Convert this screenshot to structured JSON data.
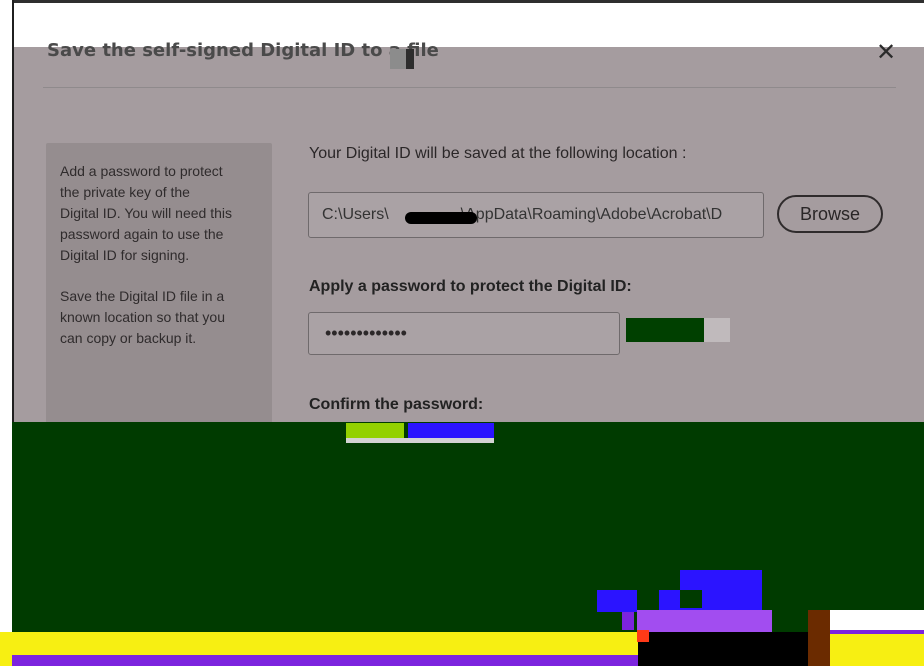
{
  "dialog": {
    "title": "Save the self-signed Digital ID to a file",
    "close_symbol": "✕"
  },
  "info_panel": {
    "paragraph1": "Add a password to protect\nthe private key of the\nDigital ID. You will need this\npassword again to use the\nDigital ID for signing.",
    "paragraph2": "Save the Digital ID file in a\nknown location so that you\ncan copy or backup it."
  },
  "location": {
    "label": "Your Digital ID will be saved at the following location :",
    "path_before_redaction": "C:\\Users\\",
    "path_after_redaction": "\\AppData\\Roaming\\Adobe\\Acrobat\\D",
    "browse_label": "Browse"
  },
  "password": {
    "label": "Apply a password to protect the Digital ID:",
    "masked_value": "•••••••••••••",
    "strength_fraction": 0.75
  },
  "confirm": {
    "label": "Confirm the password:"
  },
  "colors": {
    "dialog_background": "#a59c9f",
    "panel_background": "#958d8f",
    "strength_color": "#004000",
    "glitch_green": "#003b00",
    "glitch_yellow": "#f7ef12",
    "glitch_blue": "#2b14ff",
    "glitch_purple": "#7c24de"
  },
  "icons": {
    "close": "close-icon"
  }
}
